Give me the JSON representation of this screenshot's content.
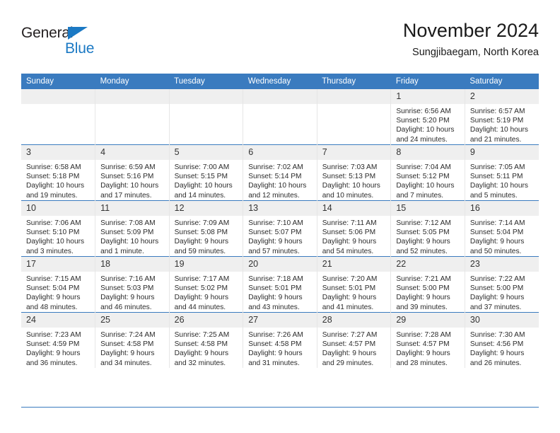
{
  "brand": {
    "name_part1": "General",
    "name_part2": "Blue",
    "accent_color": "#1b79c4"
  },
  "header": {
    "title": "November 2024",
    "subtitle": "Sungjibaegam, North Korea"
  },
  "theme": {
    "header_blue": "#3a7bbf",
    "daynum_band": "#efefef",
    "cell_border": "#e6e6e6"
  },
  "weekday_headers": [
    "Sunday",
    "Monday",
    "Tuesday",
    "Wednesday",
    "Thursday",
    "Friday",
    "Saturday"
  ],
  "weeks": [
    [
      {
        "day": "",
        "sunrise": "",
        "sunset": "",
        "daylight1": "",
        "daylight2": ""
      },
      {
        "day": "",
        "sunrise": "",
        "sunset": "",
        "daylight1": "",
        "daylight2": ""
      },
      {
        "day": "",
        "sunrise": "",
        "sunset": "",
        "daylight1": "",
        "daylight2": ""
      },
      {
        "day": "",
        "sunrise": "",
        "sunset": "",
        "daylight1": "",
        "daylight2": ""
      },
      {
        "day": "",
        "sunrise": "",
        "sunset": "",
        "daylight1": "",
        "daylight2": ""
      },
      {
        "day": "1",
        "sunrise": "Sunrise: 6:56 AM",
        "sunset": "Sunset: 5:20 PM",
        "daylight1": "Daylight: 10 hours",
        "daylight2": "and 24 minutes."
      },
      {
        "day": "2",
        "sunrise": "Sunrise: 6:57 AM",
        "sunset": "Sunset: 5:19 PM",
        "daylight1": "Daylight: 10 hours",
        "daylight2": "and 21 minutes."
      }
    ],
    [
      {
        "day": "3",
        "sunrise": "Sunrise: 6:58 AM",
        "sunset": "Sunset: 5:18 PM",
        "daylight1": "Daylight: 10 hours",
        "daylight2": "and 19 minutes."
      },
      {
        "day": "4",
        "sunrise": "Sunrise: 6:59 AM",
        "sunset": "Sunset: 5:16 PM",
        "daylight1": "Daylight: 10 hours",
        "daylight2": "and 17 minutes."
      },
      {
        "day": "5",
        "sunrise": "Sunrise: 7:00 AM",
        "sunset": "Sunset: 5:15 PM",
        "daylight1": "Daylight: 10 hours",
        "daylight2": "and 14 minutes."
      },
      {
        "day": "6",
        "sunrise": "Sunrise: 7:02 AM",
        "sunset": "Sunset: 5:14 PM",
        "daylight1": "Daylight: 10 hours",
        "daylight2": "and 12 minutes."
      },
      {
        "day": "7",
        "sunrise": "Sunrise: 7:03 AM",
        "sunset": "Sunset: 5:13 PM",
        "daylight1": "Daylight: 10 hours",
        "daylight2": "and 10 minutes."
      },
      {
        "day": "8",
        "sunrise": "Sunrise: 7:04 AM",
        "sunset": "Sunset: 5:12 PM",
        "daylight1": "Daylight: 10 hours",
        "daylight2": "and 7 minutes."
      },
      {
        "day": "9",
        "sunrise": "Sunrise: 7:05 AM",
        "sunset": "Sunset: 5:11 PM",
        "daylight1": "Daylight: 10 hours",
        "daylight2": "and 5 minutes."
      }
    ],
    [
      {
        "day": "10",
        "sunrise": "Sunrise: 7:06 AM",
        "sunset": "Sunset: 5:10 PM",
        "daylight1": "Daylight: 10 hours",
        "daylight2": "and 3 minutes."
      },
      {
        "day": "11",
        "sunrise": "Sunrise: 7:08 AM",
        "sunset": "Sunset: 5:09 PM",
        "daylight1": "Daylight: 10 hours",
        "daylight2": "and 1 minute."
      },
      {
        "day": "12",
        "sunrise": "Sunrise: 7:09 AM",
        "sunset": "Sunset: 5:08 PM",
        "daylight1": "Daylight: 9 hours",
        "daylight2": "and 59 minutes."
      },
      {
        "day": "13",
        "sunrise": "Sunrise: 7:10 AM",
        "sunset": "Sunset: 5:07 PM",
        "daylight1": "Daylight: 9 hours",
        "daylight2": "and 57 minutes."
      },
      {
        "day": "14",
        "sunrise": "Sunrise: 7:11 AM",
        "sunset": "Sunset: 5:06 PM",
        "daylight1": "Daylight: 9 hours",
        "daylight2": "and 54 minutes."
      },
      {
        "day": "15",
        "sunrise": "Sunrise: 7:12 AM",
        "sunset": "Sunset: 5:05 PM",
        "daylight1": "Daylight: 9 hours",
        "daylight2": "and 52 minutes."
      },
      {
        "day": "16",
        "sunrise": "Sunrise: 7:14 AM",
        "sunset": "Sunset: 5:04 PM",
        "daylight1": "Daylight: 9 hours",
        "daylight2": "and 50 minutes."
      }
    ],
    [
      {
        "day": "17",
        "sunrise": "Sunrise: 7:15 AM",
        "sunset": "Sunset: 5:04 PM",
        "daylight1": "Daylight: 9 hours",
        "daylight2": "and 48 minutes."
      },
      {
        "day": "18",
        "sunrise": "Sunrise: 7:16 AM",
        "sunset": "Sunset: 5:03 PM",
        "daylight1": "Daylight: 9 hours",
        "daylight2": "and 46 minutes."
      },
      {
        "day": "19",
        "sunrise": "Sunrise: 7:17 AM",
        "sunset": "Sunset: 5:02 PM",
        "daylight1": "Daylight: 9 hours",
        "daylight2": "and 44 minutes."
      },
      {
        "day": "20",
        "sunrise": "Sunrise: 7:18 AM",
        "sunset": "Sunset: 5:01 PM",
        "daylight1": "Daylight: 9 hours",
        "daylight2": "and 43 minutes."
      },
      {
        "day": "21",
        "sunrise": "Sunrise: 7:20 AM",
        "sunset": "Sunset: 5:01 PM",
        "daylight1": "Daylight: 9 hours",
        "daylight2": "and 41 minutes."
      },
      {
        "day": "22",
        "sunrise": "Sunrise: 7:21 AM",
        "sunset": "Sunset: 5:00 PM",
        "daylight1": "Daylight: 9 hours",
        "daylight2": "and 39 minutes."
      },
      {
        "day": "23",
        "sunrise": "Sunrise: 7:22 AM",
        "sunset": "Sunset: 5:00 PM",
        "daylight1": "Daylight: 9 hours",
        "daylight2": "and 37 minutes."
      }
    ],
    [
      {
        "day": "24",
        "sunrise": "Sunrise: 7:23 AM",
        "sunset": "Sunset: 4:59 PM",
        "daylight1": "Daylight: 9 hours",
        "daylight2": "and 36 minutes."
      },
      {
        "day": "25",
        "sunrise": "Sunrise: 7:24 AM",
        "sunset": "Sunset: 4:58 PM",
        "daylight1": "Daylight: 9 hours",
        "daylight2": "and 34 minutes."
      },
      {
        "day": "26",
        "sunrise": "Sunrise: 7:25 AM",
        "sunset": "Sunset: 4:58 PM",
        "daylight1": "Daylight: 9 hours",
        "daylight2": "and 32 minutes."
      },
      {
        "day": "27",
        "sunrise": "Sunrise: 7:26 AM",
        "sunset": "Sunset: 4:58 PM",
        "daylight1": "Daylight: 9 hours",
        "daylight2": "and 31 minutes."
      },
      {
        "day": "28",
        "sunrise": "Sunrise: 7:27 AM",
        "sunset": "Sunset: 4:57 PM",
        "daylight1": "Daylight: 9 hours",
        "daylight2": "and 29 minutes."
      },
      {
        "day": "29",
        "sunrise": "Sunrise: 7:28 AM",
        "sunset": "Sunset: 4:57 PM",
        "daylight1": "Daylight: 9 hours",
        "daylight2": "and 28 minutes."
      },
      {
        "day": "30",
        "sunrise": "Sunrise: 7:30 AM",
        "sunset": "Sunset: 4:56 PM",
        "daylight1": "Daylight: 9 hours",
        "daylight2": "and 26 minutes."
      }
    ]
  ]
}
